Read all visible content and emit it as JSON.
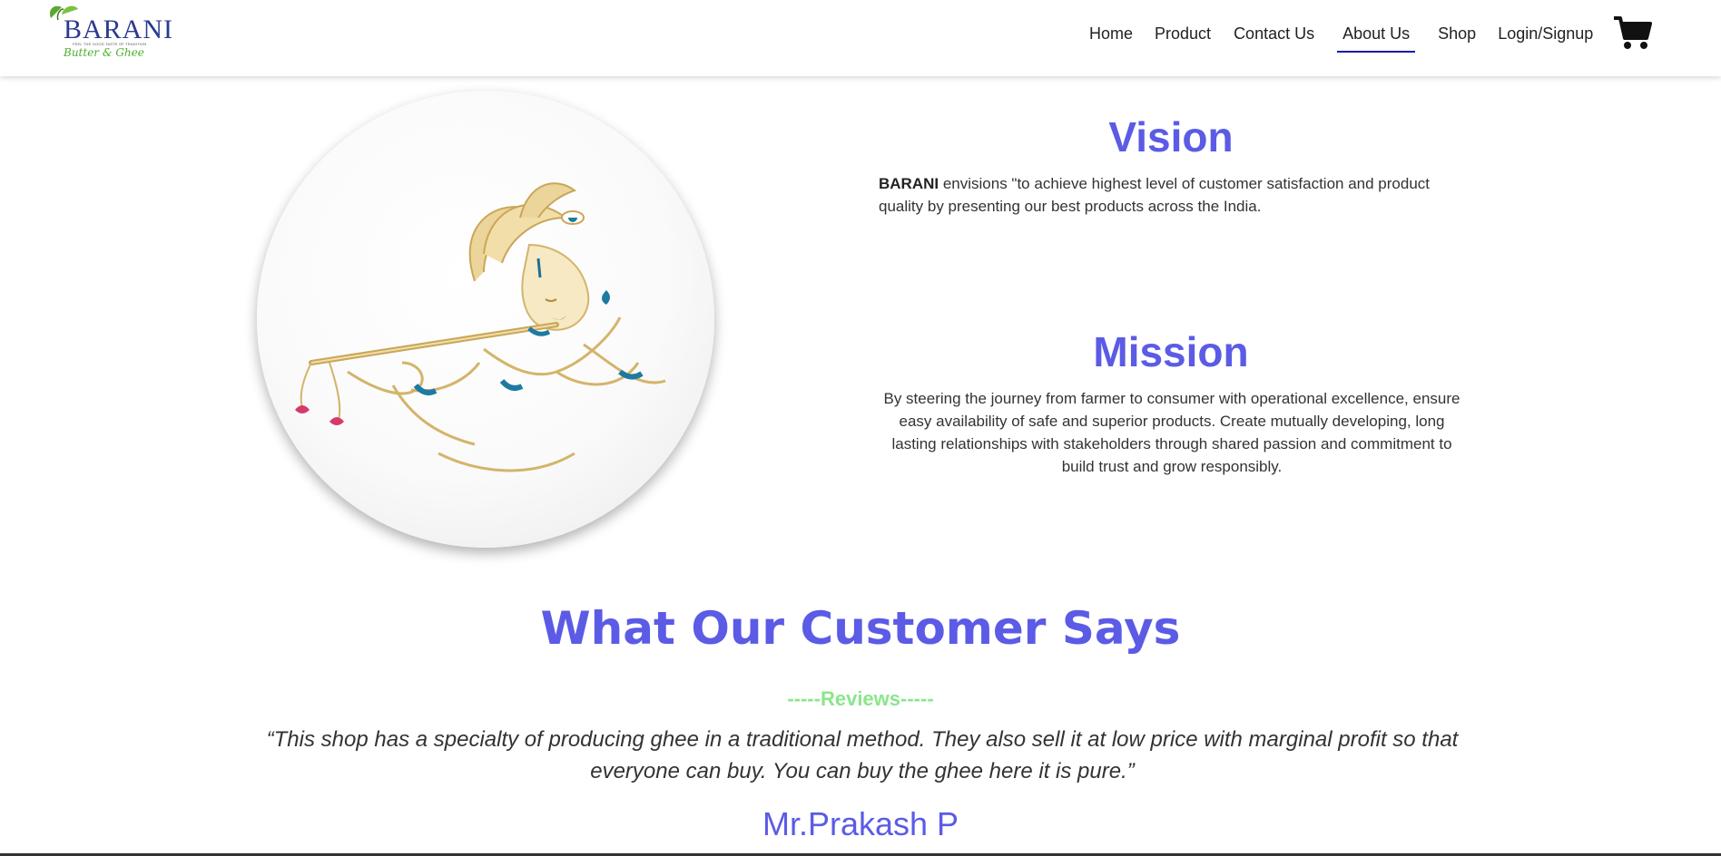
{
  "brand": {
    "name": "BARANI",
    "tagline": "FEEL THE GOOD TASTE OF TRADITION",
    "subtitle": "Butter & Ghee"
  },
  "nav": {
    "items": [
      {
        "label": "Home"
      },
      {
        "label": "Product"
      },
      {
        "label": "Contact Us"
      },
      {
        "label": "About Us"
      },
      {
        "label": "Shop"
      },
      {
        "label": "Login/Signup"
      }
    ],
    "active": "About Us",
    "cart_icon": "shopping-cart-icon"
  },
  "vision": {
    "title": "Vision",
    "brand_bold": "BARANI",
    "text": " envisions \"to achieve highest level of customer satisfaction and product quality by presenting our best products across the India."
  },
  "mission": {
    "title": "Mission",
    "text": "By steering the journey from farmer to consumer with operational excellence, ensure easy availability of safe and superior products. Create mutually developing, long lasting relationships with stakeholders through shared passion and commitment to build trust and grow responsibly."
  },
  "testimonials": {
    "title": "What Our Customer Says",
    "label": "-----Reviews-----",
    "quote": "“This shop has a specialty of producing ghee in a traditional method. They also sell it at low price with marginal profit so that everyone can buy. You can buy the ghee here it is pure.”",
    "author": "Mr.Prakash P"
  },
  "colors": {
    "accent": "#5b5be6",
    "reviews_label": "#8be68b",
    "nav_underline": "#1a1aa5",
    "logo_text": "#2b3a8f",
    "logo_green": "#4caf2c"
  }
}
